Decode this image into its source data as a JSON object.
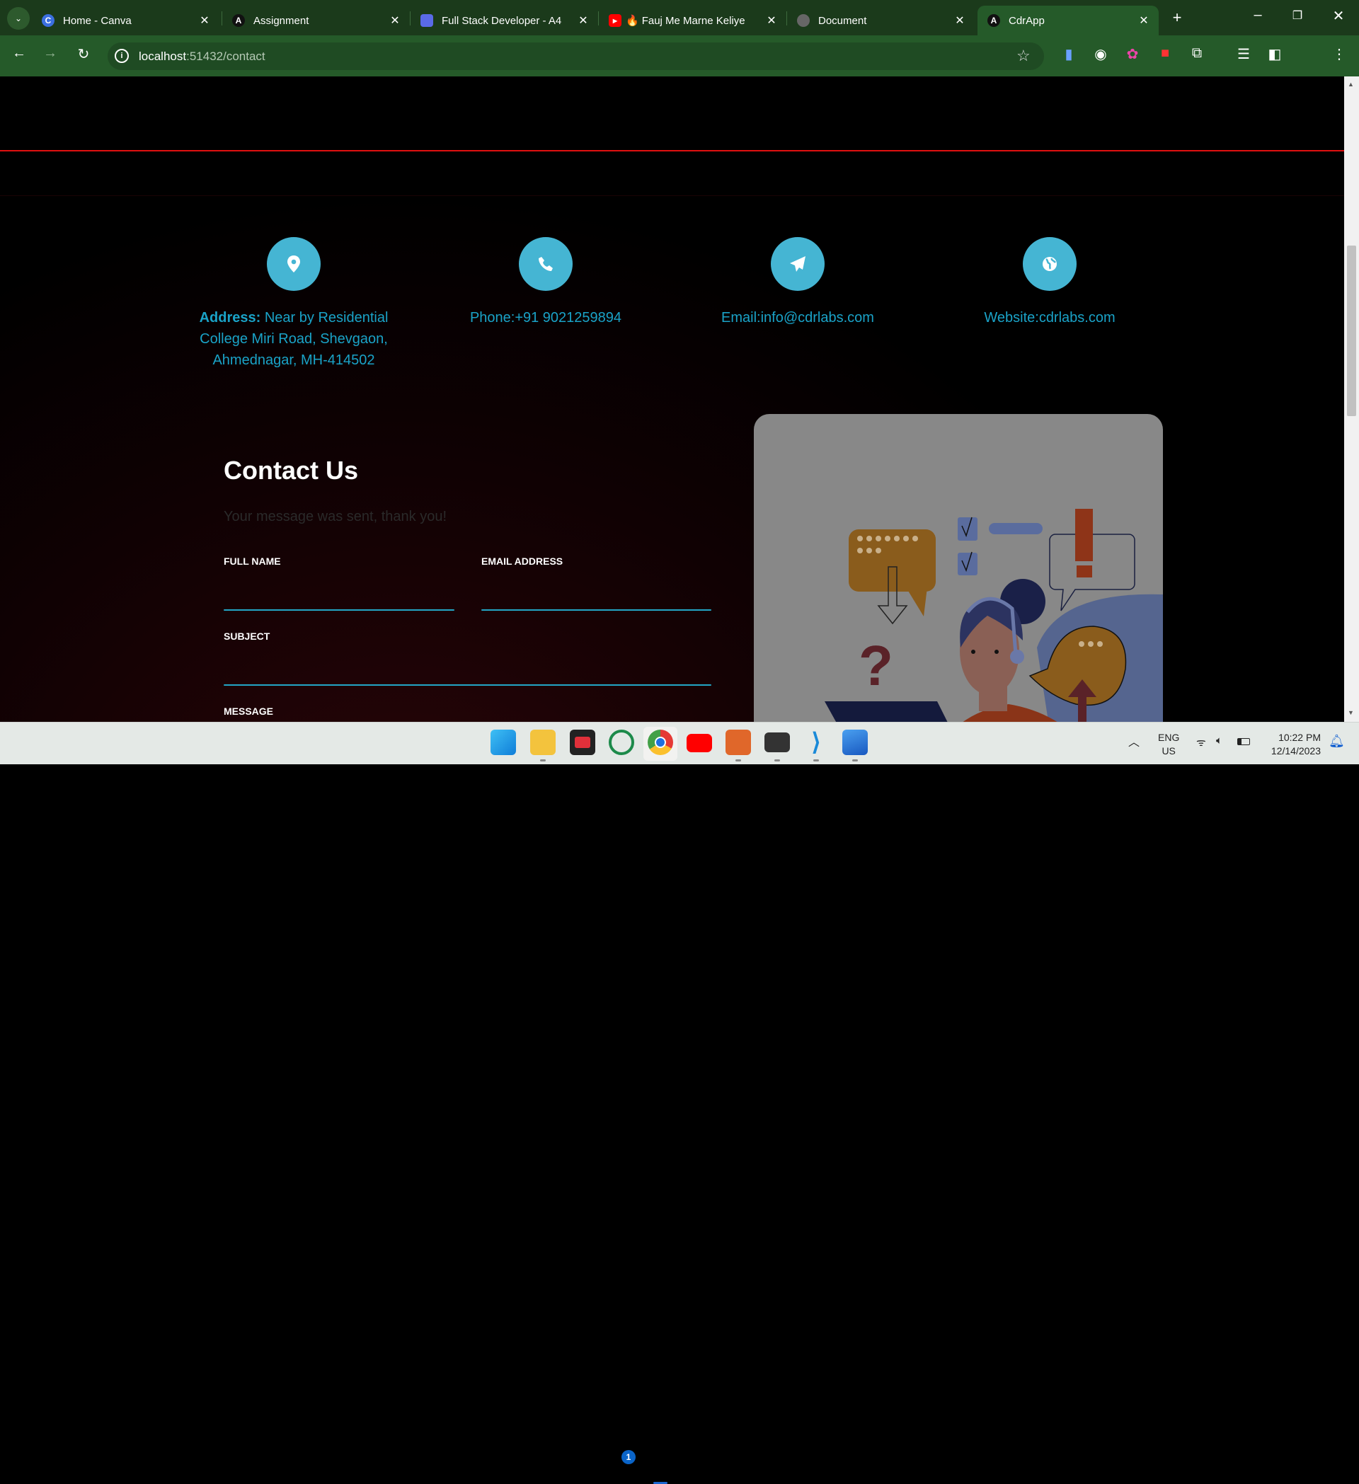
{
  "browser": {
    "tabs": [
      {
        "title": "Home - Canva",
        "icon": "canva-icon"
      },
      {
        "title": "Assignment",
        "icon": "angular-icon"
      },
      {
        "title": "Full Stack Developer - A4",
        "icon": "doc-icon"
      },
      {
        "title": "Fauj Me Marne Keliye",
        "icon": "youtube-icon"
      },
      {
        "title": "Document",
        "icon": "globe-icon"
      },
      {
        "title": "CdrApp",
        "icon": "angular-icon",
        "active": true
      }
    ],
    "url_host": "localhost",
    "url_path": ":51432/contact"
  },
  "contact_info": [
    {
      "label": "Address:",
      "value": " Near by Residential College Miri Road, Shevgaon, Ahmednagar, MH-414502",
      "icon": "location-pin-icon"
    },
    {
      "label": "Phone:",
      "value": "+91 9021259894",
      "icon": "phone-icon"
    },
    {
      "label": "Email:",
      "value": "info@cdrlabs.com",
      "icon": "paper-plane-icon"
    },
    {
      "label": "Website:",
      "value": "cdrlabs.com",
      "icon": "globe-icon"
    }
  ],
  "form": {
    "title": "Contact Us",
    "status": "Your message was sent, thank you!",
    "full_name_label": "FULL NAME",
    "email_label": "EMAIL ADDRESS",
    "subject_label": "SUBJECT",
    "message_label": "MESSAGE"
  },
  "taskbar": {
    "lang": "ENG",
    "region": "US",
    "time": "10:22 PM",
    "date": "12/14/2023",
    "whatsapp_badge": "1"
  },
  "colors": {
    "accent": "#45b5d3",
    "info_text": "#1aa3c8",
    "divider": "#e01010"
  }
}
